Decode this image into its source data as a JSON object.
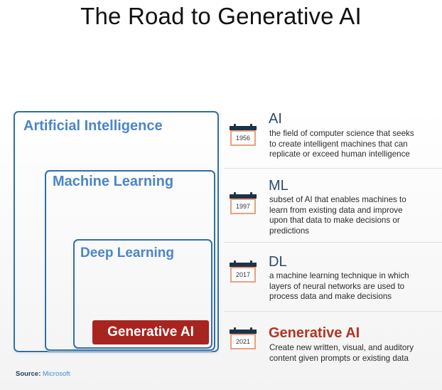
{
  "title": "The Road to Generative AI",
  "boxes": {
    "ai": "Artificial Intelligence",
    "ml": "Machine Learning",
    "dl": "Deep Learning",
    "gen": "Generative AI"
  },
  "entries": [
    {
      "abbr": "AI",
      "year": "1956",
      "lines": [
        "the field of computer science that seeks",
        "to create intelligent machines that can",
        "replicate or exceed human intelligence"
      ]
    },
    {
      "abbr": "ML",
      "year": "1997",
      "lines": [
        "subset of AI that enables machines to",
        "learn from existing data and improve",
        "upon that data to make decisions or",
        "predictions"
      ]
    },
    {
      "abbr": "DL",
      "year": "2017",
      "lines": [
        "a machine learning technique in which",
        "layers of neural networks are used to",
        "process data and make decisions"
      ]
    },
    {
      "abbr": "Generative AI",
      "year": "2021",
      "lines": [
        "Create new written, visual, and auditory",
        "content given prompts or existing data"
      ]
    }
  ],
  "source": {
    "label": "Source:",
    "value": "Microsoft"
  },
  "colors": {
    "box_border": "#2f6fa6",
    "box_label": "#4a86c8",
    "gen_badge": "#a8241f",
    "gen_heading": "#b5341f",
    "heading": "#2c4b6d",
    "calendar": "#1d3348",
    "calendar_accent": "#e8a080"
  },
  "icons": [
    "calendar-icon"
  ]
}
